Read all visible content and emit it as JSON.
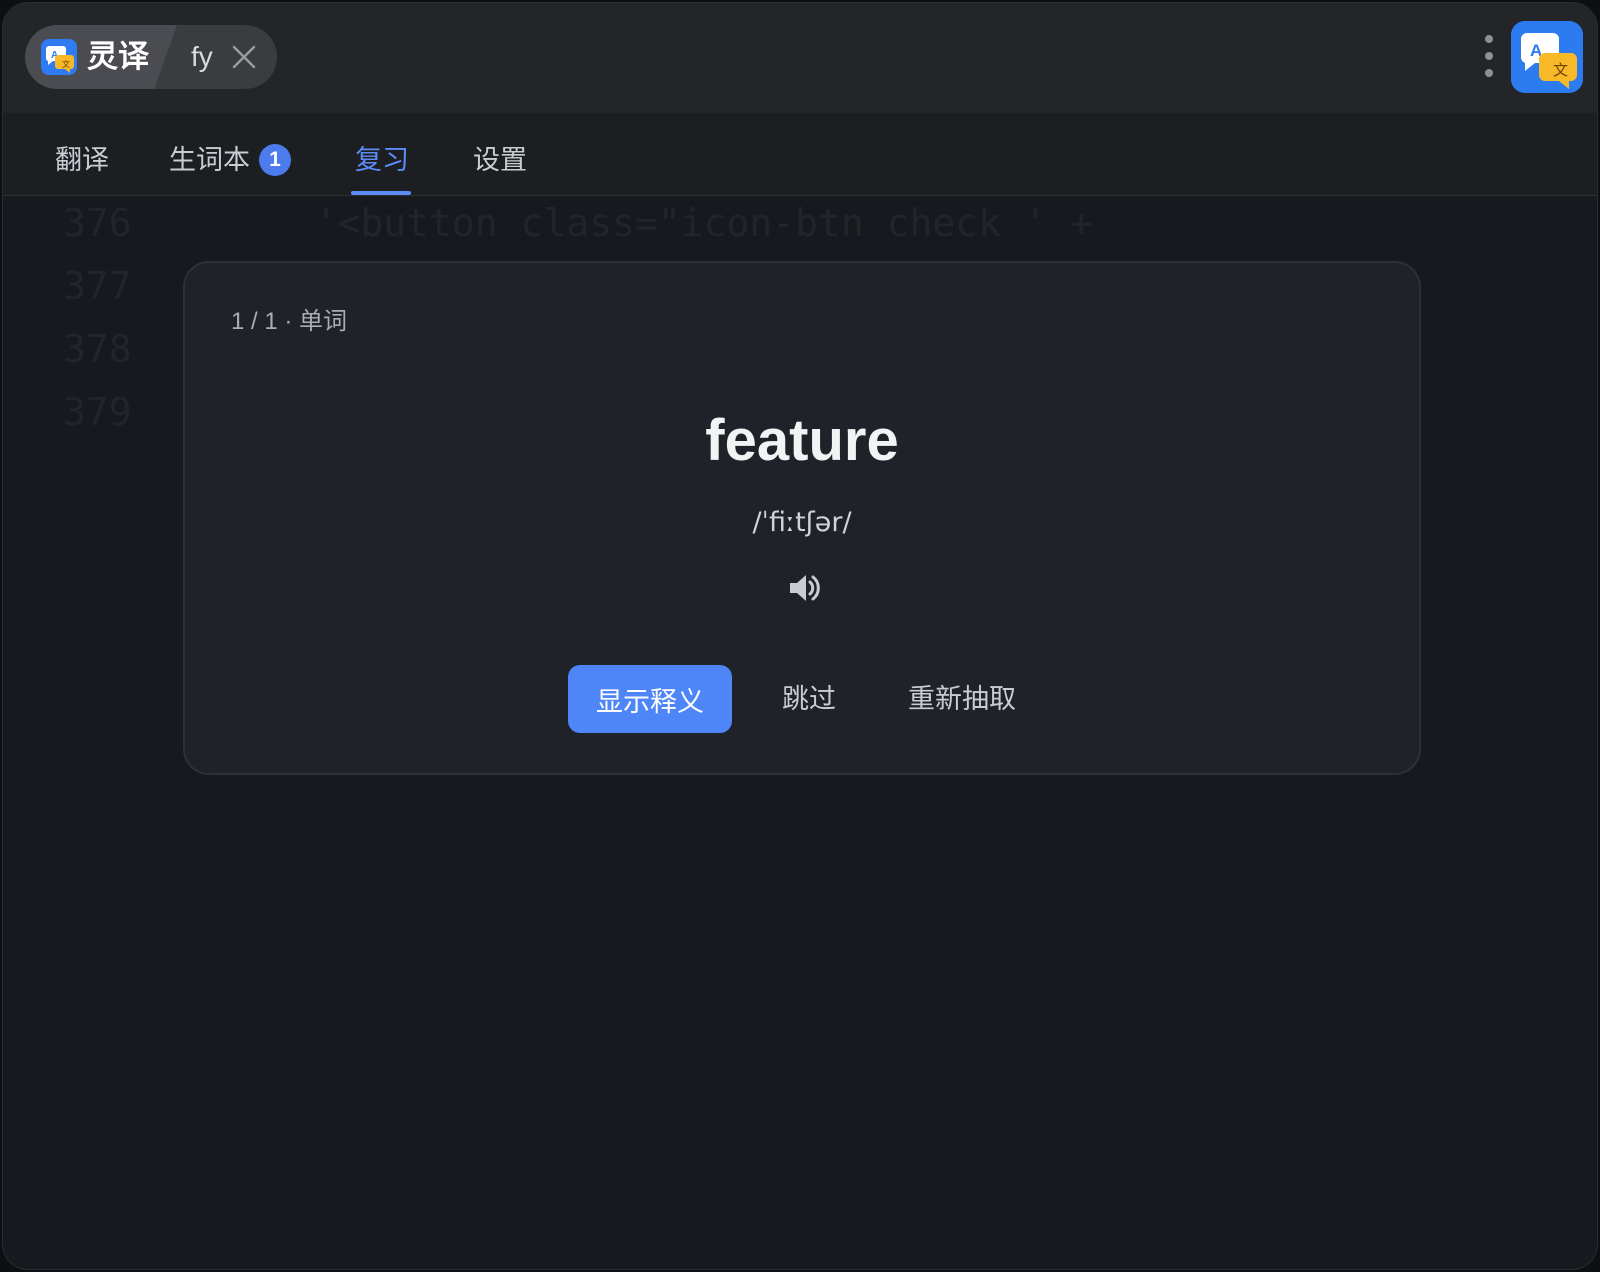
{
  "titlebar": {
    "app_name": "灵译",
    "keyword": "fy",
    "icons": {
      "app_logo": "translate-app-icon",
      "close": "close-icon",
      "menu": "more-vertical-icon"
    }
  },
  "tabs": [
    {
      "label": "翻译",
      "active": false
    },
    {
      "label": "生词本",
      "active": false,
      "badge": "1"
    },
    {
      "label": "复习",
      "active": true
    },
    {
      "label": "设置",
      "active": false
    }
  ],
  "review": {
    "counter": "1 / 1 · 单词",
    "word": "feature",
    "phonetic": "/ˈfiːtʃər/",
    "show_meaning_label": "显示释义",
    "skip_label": "跳过",
    "redraw_label": "重新抽取"
  },
  "colors": {
    "accent": "#4f86f7",
    "tab_active": "#5b8cf6",
    "background": "#17191e",
    "card": "#1f2228"
  }
}
